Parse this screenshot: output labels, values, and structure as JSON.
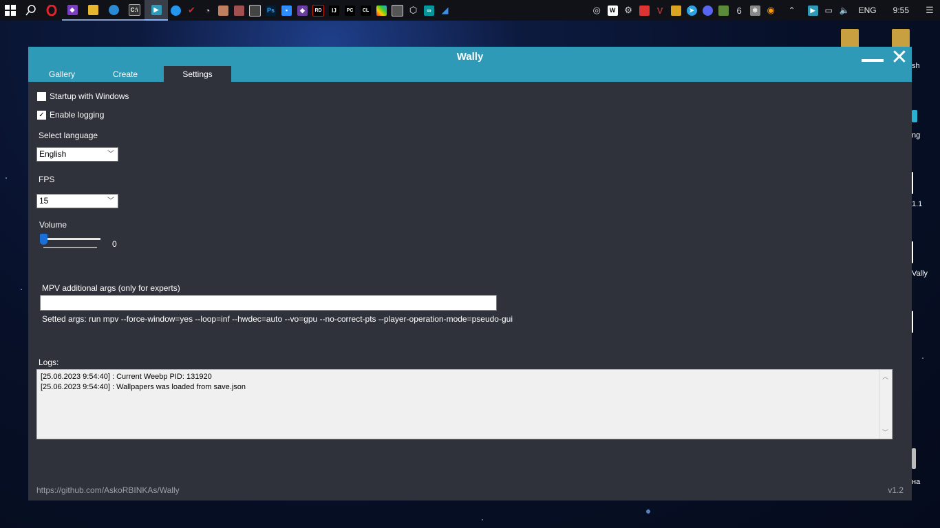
{
  "taskbar": {
    "apps": [
      "start-icon",
      "search-icon",
      "opera-icon",
      "visual-studio-icon",
      "file-explorer-icon",
      "edge-icon",
      "terminal-icon",
      "wally-icon",
      "docker-icon",
      "app-red-icon",
      "app-clock-icon",
      "app-char1-icon",
      "app-char2-icon",
      "app-windows-icon",
      "photoshop-icon",
      "zoom-icon",
      "vscode-icon",
      "rider-icon",
      "intellij-icon",
      "pycharm-icon",
      "clion-icon",
      "app-multicolor-icon",
      "app-image-icon",
      "unity-icon",
      "arduino-icon",
      "app-blue-icon"
    ],
    "running_apps": [
      "chrome-icon",
      "wally-tray-icon",
      "steam-icon",
      "app-stripes-icon",
      "app-v-icon",
      "app-yellow-icon",
      "telegram-icon",
      "discord-icon",
      "minecraft-icon",
      "app-6-icon",
      "app-gear-icon",
      "app-circle-icon"
    ],
    "tray": {
      "language": "ENG",
      "time": "9:55"
    }
  },
  "desktop": {
    "labels": [
      "sh",
      "ng",
      "1.1",
      "Vally",
      "на"
    ]
  },
  "window": {
    "title": "Wally",
    "tabs": [
      {
        "label": "Gallery",
        "active": false
      },
      {
        "label": "Create",
        "active": false
      },
      {
        "label": "Settings",
        "active": true
      }
    ],
    "settings": {
      "startup_label": "Startup with Windows",
      "startup_checked": false,
      "logging_label": "Enable logging",
      "logging_checked": true,
      "logging_check_mark": "✓",
      "language_label": "Select language",
      "language_value": "English",
      "fps_label": "FPS",
      "fps_value": "15",
      "volume_label": "Volume",
      "volume_value": "0",
      "mpv_label": "MPV additional args (only for experts)",
      "mpv_value": "",
      "setted_args": "Setted args: run mpv --force-window=yes --loop=inf --hwdec=auto --vo=gpu --no-correct-pts --player-operation-mode=pseudo-gui"
    },
    "logs": {
      "label": "Logs:",
      "lines": [
        "[25.06.2023 9:54:40] : Current Weebp PID: 131920",
        "[25.06.2023 9:54:40] : Wallpapers was loaded from save.json"
      ]
    },
    "footer": {
      "link": "https://github.com/AskoRBINKAs/Wally",
      "version": "v1.2"
    }
  }
}
